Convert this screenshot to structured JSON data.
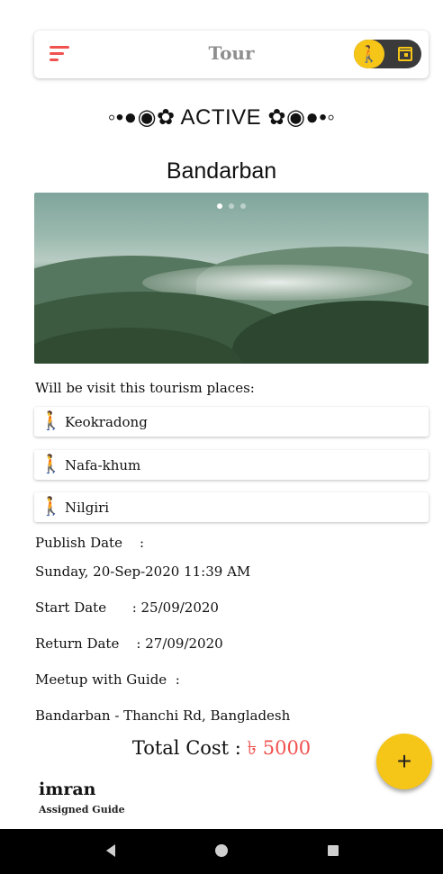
{
  "appbar": {
    "title": "Tour",
    "menu_icon": "hamburger-menu-icon",
    "toggle_left_icon": "hiking-icon",
    "toggle_right_icon": "calendar-icon"
  },
  "status": "◦•●◉✿ ACTIVE ✿◉●•◦",
  "destination": "Bandarban",
  "carousel": {
    "image": "mountain-landscape-photo",
    "pages": 3,
    "active_page": 1
  },
  "visit_label": "Will be visit this tourism places:",
  "places": [
    {
      "icon": "hiking-icon",
      "name": "Keokradong"
    },
    {
      "icon": "hiking-icon",
      "name": "Nafa-khum"
    },
    {
      "icon": "hiking-icon",
      "name": "Nilgiri"
    }
  ],
  "details": {
    "publish_label": "Publish Date    :",
    "publish_value": "Sunday, 20-Sep-2020 11:39 AM",
    "start_line": "Start Date      : 25/09/2020",
    "return_line": "Return Date    : 27/09/2020",
    "meetup_label": "Meetup with Guide  :",
    "meetup_value": "Bandarban - Thanchi Rd, Bangladesh"
  },
  "total": {
    "label": "Total Cost : ",
    "currency": "৳",
    "amount": "5000"
  },
  "guide": {
    "name": "imran",
    "role": "Assigned Guide"
  },
  "fab": {
    "icon": "add-icon",
    "label": "+"
  },
  "colors": {
    "accent_red": "#f0524f",
    "accent_yellow": "#f5c518"
  }
}
